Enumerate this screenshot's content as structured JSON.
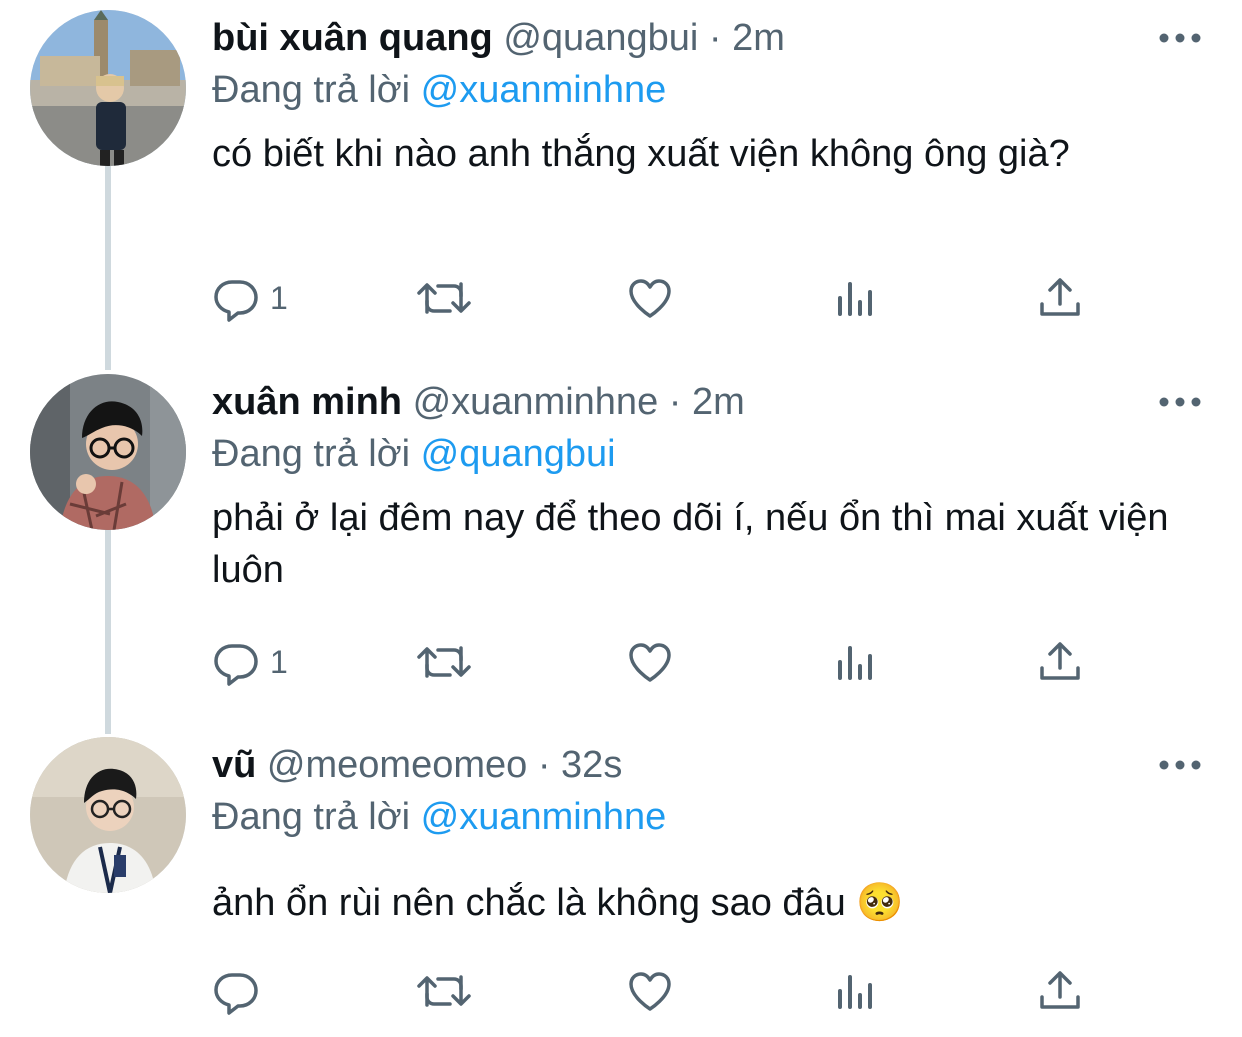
{
  "colors": {
    "accent": "#1d9bf0",
    "secondary_text": "#536471",
    "thread_line": "#cfd9de"
  },
  "reply_prefix": "Đang trả lời",
  "tweets": [
    {
      "name": "bùi xuân quang",
      "handle": "@quangbui",
      "separator": "·",
      "time": "2m",
      "reply_to": "@xuanminhne",
      "text": "có biết khi nào anh thắng xuất viện không ông già?",
      "reply_count": "1",
      "avatar_icon": "user-avatar-photo"
    },
    {
      "name": "xuân minh",
      "handle": "@xuanminhne",
      "separator": "·",
      "time": "2m",
      "reply_to": "@quangbui",
      "text": "phải ở lại đêm nay để theo dõi í, nếu ổn thì mai xuất viện luôn",
      "reply_count": "1",
      "avatar_icon": "user-avatar-photo"
    },
    {
      "name": "vũ",
      "handle": "@meomeomeo",
      "separator": "·",
      "time": "32s",
      "reply_to": "@xuanminhne",
      "text": "ảnh ổn rùi nên chắc là không sao đâu 🥺",
      "reply_count": "",
      "avatar_icon": "user-avatar-photo"
    }
  ],
  "action_icons": [
    "reply-icon",
    "retweet-icon",
    "like-icon",
    "analytics-icon",
    "share-icon"
  ]
}
